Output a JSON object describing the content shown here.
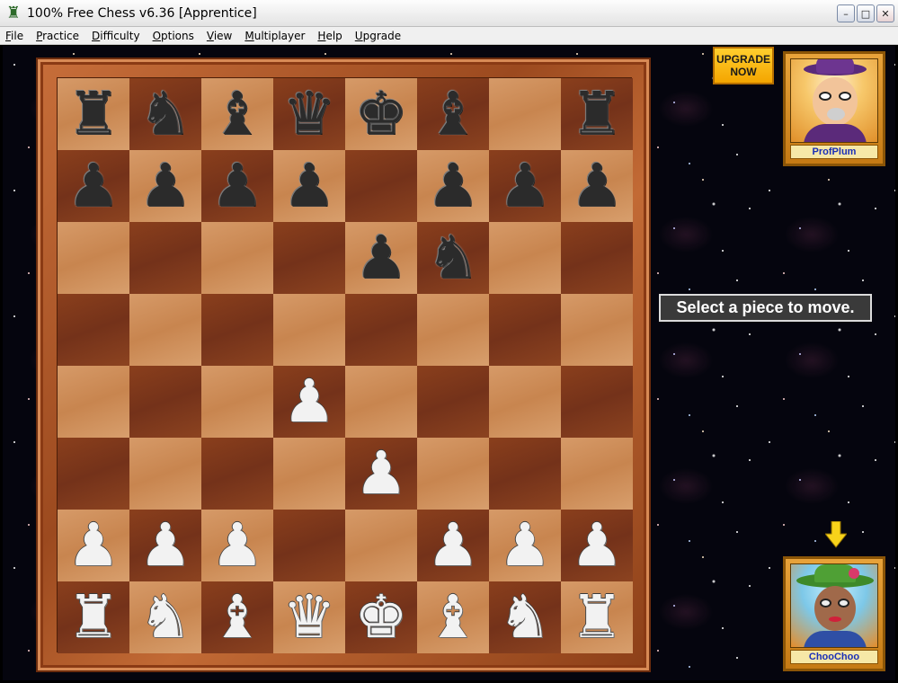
{
  "window": {
    "title": "100% Free Chess v6.36 [Apprentice]",
    "controls": {
      "minimize": "–",
      "maximize": "□",
      "close": "✕"
    }
  },
  "menu": [
    {
      "label": "File",
      "accel": "F",
      "rest": "ile"
    },
    {
      "label": "Practice",
      "accel": "P",
      "rest": "ractice"
    },
    {
      "label": "Difficulty",
      "accel": "D",
      "rest": "ifficulty"
    },
    {
      "label": "Options",
      "accel": "O",
      "rest": "ptions"
    },
    {
      "label": "View",
      "accel": "V",
      "rest": "iew"
    },
    {
      "label": "Multiplayer",
      "accel": "M",
      "rest": "ultiplayer"
    },
    {
      "label": "Help",
      "accel": "H",
      "rest": "elp"
    },
    {
      "label": "Upgrade",
      "accel": "U",
      "rest": "pgrade"
    }
  ],
  "board": {
    "rows": [
      [
        "r",
        "n",
        "b",
        "q",
        "k",
        "b",
        "",
        "r"
      ],
      [
        "p",
        "p",
        "p",
        "p",
        "",
        "p",
        "p",
        "p"
      ],
      [
        "",
        "",
        "",
        "",
        "p",
        "n",
        "",
        ""
      ],
      [
        "",
        "",
        "",
        "",
        "",
        "",
        "",
        ""
      ],
      [
        "",
        "",
        "",
        "P",
        "",
        "",
        "",
        ""
      ],
      [
        "",
        "",
        "",
        "",
        "P",
        "",
        "",
        ""
      ],
      [
        "P",
        "P",
        "P",
        "",
        "",
        "P",
        "P",
        "P"
      ],
      [
        "R",
        "N",
        "B",
        "Q",
        "K",
        "B",
        "N",
        "R"
      ]
    ],
    "light_color": "#d69a68",
    "dark_color": "#7a361a"
  },
  "upgrade_button": {
    "line1": "UPGRADE",
    "line2": "NOW"
  },
  "players": {
    "opponent": {
      "name": "ProfPlum"
    },
    "self": {
      "name": "ChooChoo"
    }
  },
  "status_message": "Select a piece to move.",
  "turn_indicator": "arrow-down-icon"
}
